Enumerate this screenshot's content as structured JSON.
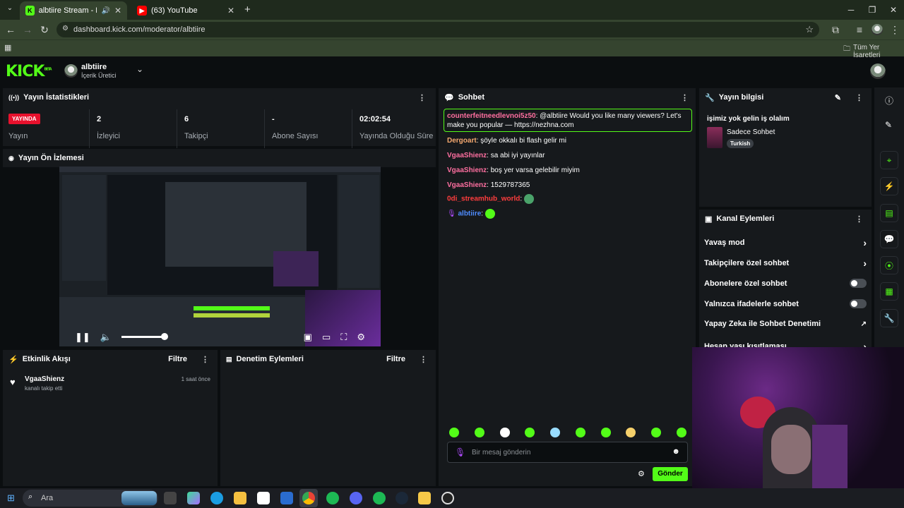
{
  "browser": {
    "tabs": [
      {
        "title": "albtiire Stream - Kick Dashb"
      },
      {
        "title": "(63) YouTube"
      }
    ],
    "url": "dashboard.kick.com/moderator/albtiire",
    "bookmarks_label": "Tüm Yer İşaretleri"
  },
  "header": {
    "logo": "KICK",
    "logo_badge": "BETA",
    "username": "albtiire",
    "role": "İçerik Üretici"
  },
  "stats": {
    "title": "Yayın İstatistikleri",
    "live_badge": "YAYINDA",
    "items": [
      {
        "value": "",
        "label": "Yayın"
      },
      {
        "value": "2",
        "label": "İzleyici"
      },
      {
        "value": "6",
        "label": "Takipçi"
      },
      {
        "value": "-",
        "label": "Abone Sayısı"
      },
      {
        "value": "02:02:54",
        "label": "Yayında Olduğu Süre"
      }
    ]
  },
  "preview": {
    "title": "Yayın Ön İzlemesi"
  },
  "activity": {
    "title": "Etkinlik Akışı",
    "filter": "Filtre",
    "events": [
      {
        "user": "VgaaShienz",
        "action": "kanalı takip etti",
        "time": "1 saat önce"
      }
    ]
  },
  "moderation": {
    "title": "Denetim Eylemleri",
    "filter": "Filtre"
  },
  "chat": {
    "title": "Sohbet",
    "messages": [
      {
        "user": "counterfeitneedlevnoi5z50",
        "text": ": @albtiire Would you like many viewers? Let's make you popular — https://nezhna.com"
      },
      {
        "user": "Dergoart",
        "text": ": şöyle okkalı bi flash gelir mi"
      },
      {
        "user": "VgaaShienz",
        "text": ": sa abi iyi yayınlar"
      },
      {
        "user": "VgaaShienz",
        "text": ": boş yer varsa gelebilir miyim"
      },
      {
        "user": "VgaaShienz",
        "text": ": 1529787365"
      },
      {
        "user": "0di_streamhub_world",
        "text": ":"
      },
      {
        "user": "albtiire",
        "text": ":"
      }
    ],
    "placeholder": "Bir mesaj gönderin",
    "send": "Gönder"
  },
  "stream_info": {
    "title": "Yayın bilgisi",
    "stream_title": "işimiz yok gelin iş olalım",
    "category": "Sadece Sohbet",
    "language": "Turkish"
  },
  "channel_actions": {
    "title": "Kanal Eylemleri",
    "items": [
      {
        "label": "Yavaş mod"
      },
      {
        "label": "Takipçilere özel sohbet"
      },
      {
        "label": "Abonelere özel sohbet"
      },
      {
        "label": "Yalnızca ifadelerle sohbet"
      },
      {
        "label": "Yapay Zeka ile Sohbet Denetimi"
      },
      {
        "label": "Hesap yaşı kısıtlaması"
      }
    ]
  },
  "taskbar": {
    "search": "Ara"
  },
  "colors": {
    "accent": "#53fc18",
    "live": "#e8112d",
    "panel": "#16191c"
  }
}
